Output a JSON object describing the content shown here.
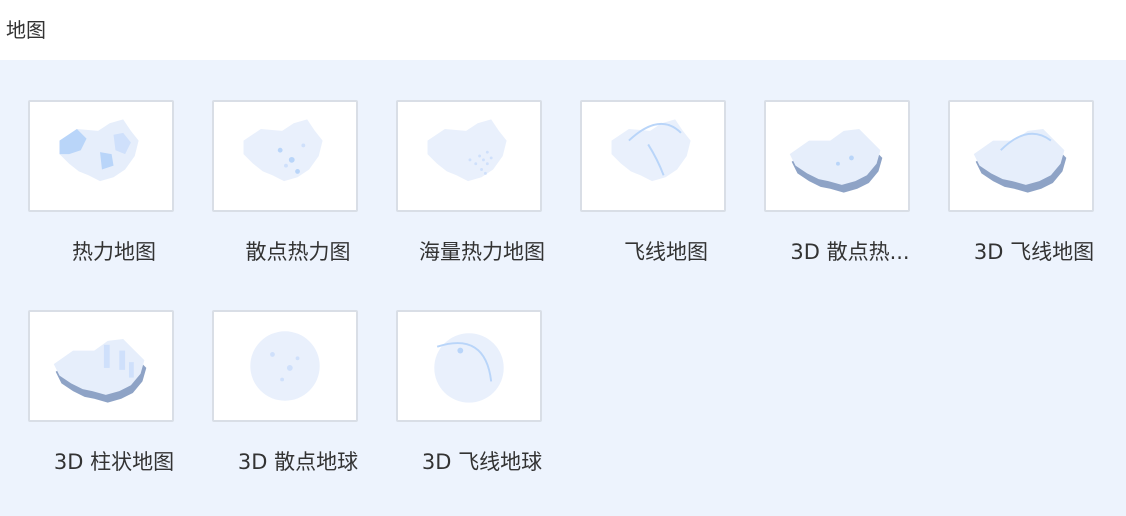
{
  "header": {
    "title": "地图"
  },
  "colors": {
    "panel_bg": "#edf3fd",
    "map_light": "#e6eefb",
    "map_mid": "#cfe0fb",
    "map_strong": "#b9d5f9",
    "shadow": "#8ea3c6"
  },
  "items": [
    {
      "label": "热力地图",
      "icon": "heat-map-icon"
    },
    {
      "label": "散点热力图",
      "icon": "scatter-heat-map-icon"
    },
    {
      "label": "海量热力地图",
      "icon": "massive-heat-map-icon"
    },
    {
      "label": "飞线地图",
      "icon": "flight-line-map-icon"
    },
    {
      "label": "3D 散点热...",
      "icon": "3d-scatter-heat-map-icon"
    },
    {
      "label": "3D 飞线地图",
      "icon": "3d-flight-line-map-icon"
    },
    {
      "label": "3D 柱状地图",
      "icon": "3d-bar-map-icon"
    },
    {
      "label": "3D 散点地球",
      "icon": "3d-scatter-globe-icon"
    },
    {
      "label": "3D 飞线地球",
      "icon": "3d-flight-line-globe-icon"
    }
  ]
}
